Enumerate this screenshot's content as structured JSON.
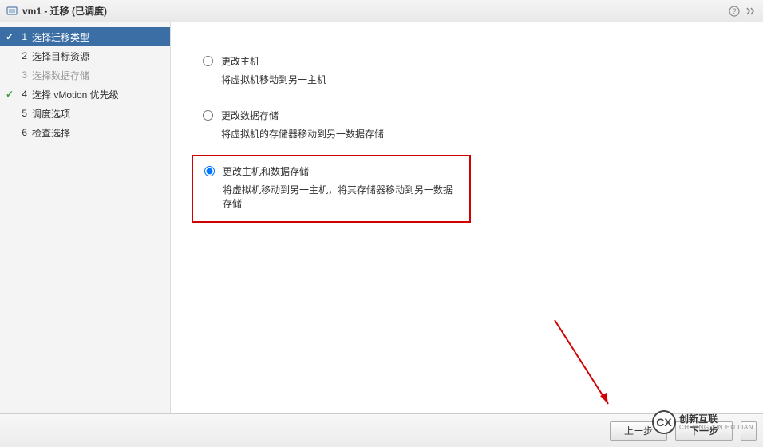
{
  "titlebar": {
    "title": "vm1 - 迁移 (已调度)"
  },
  "sidebar": {
    "steps": [
      {
        "num": "1",
        "label": "选择迁移类型",
        "state": "current",
        "check": true
      },
      {
        "num": "2",
        "label": "选择目标资源",
        "state": "normal",
        "check": false
      },
      {
        "num": "3",
        "label": "选择数据存储",
        "state": "disabled",
        "check": false
      },
      {
        "num": "4",
        "label": "选择 vMotion 优先级",
        "state": "completed",
        "check": true
      },
      {
        "num": "5",
        "label": "调度选项",
        "state": "normal",
        "check": false
      },
      {
        "num": "6",
        "label": "检查选择",
        "state": "normal",
        "check": false
      }
    ]
  },
  "options": {
    "o1": {
      "title": "更改主机",
      "desc": "将虚拟机移动到另一主机"
    },
    "o2": {
      "title": "更改数据存储",
      "desc": "将虚拟机的存储器移动到另一数据存储"
    },
    "o3": {
      "title": "更改主机和数据存储",
      "desc": "将虚拟机移动到另一主机，将其存储器移动到另一数据存储"
    }
  },
  "footer": {
    "back": "上一步",
    "next": "下一步"
  },
  "watermark": {
    "brand": "创新互联",
    "sub": "CHUANG XIN HU LIAN"
  }
}
